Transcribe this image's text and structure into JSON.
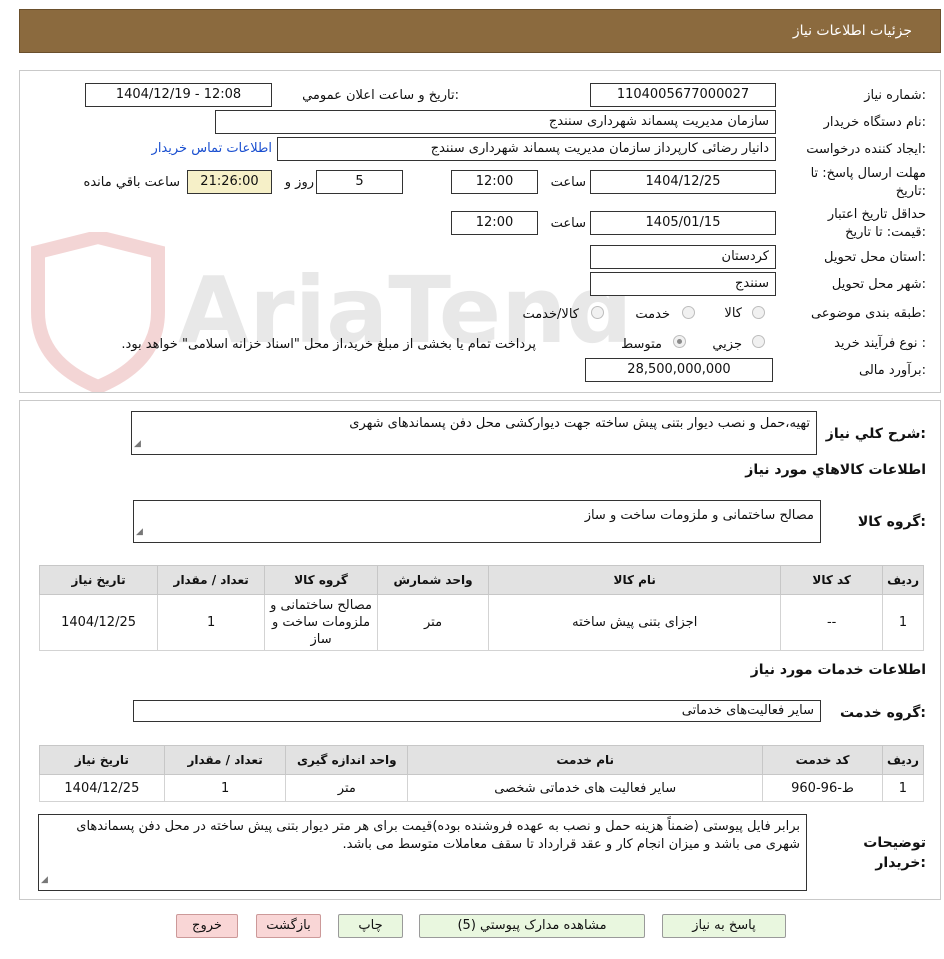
{
  "header": {
    "title": "جزئیات اطلاعات نیاز"
  },
  "form": {
    "need_number_label": "شماره نیاز:",
    "need_number": "1104005677000027",
    "announce_label": "تاریخ و ساعت اعلان عمومي:",
    "announce_value": "1404/12/19 - 12:08",
    "buyer_org_label": "نام دستگاه خریدار:",
    "buyer_org": "سازمان مدیریت پسماند شهرداری سنندج",
    "requester_label": "ایجاد کننده درخواست:",
    "requester": "دانیار رضائی کارپرداز سازمان مدیریت پسماند شهرداری سنندج",
    "contact_link": "اطلاعات تماس خریدار",
    "deadline_label": "مهلت ارسال پاسخ: تا تاریخ:",
    "deadline_date": "1404/12/25",
    "time_label": "ساعت",
    "deadline_time": "12:00",
    "days_value": "5",
    "days_label": "روز و",
    "remaining_time": "21:26:00",
    "remaining_label": "ساعت باقي مانده",
    "validity_label": "حداقل تاریخ اعتبار قیمت: تا تاریخ:",
    "validity_date": "1405/01/15",
    "validity_time": "12:00",
    "province_label": "استان محل تحویل:",
    "province": "کردستان",
    "city_label": "شهر محل تحویل:",
    "city": "سنندج",
    "category_label": "طبقه بندی موضوعی:",
    "category_options": [
      "کالا",
      "خدمت",
      "کالا/خدمت"
    ],
    "process_label": "نوع فرآیند خرید :",
    "process_options": [
      "جزیي",
      "متوسط"
    ],
    "process_note": "پرداخت تمام یا بخشی از مبلغ خرید،از محل \"اسناد خزانه اسلامی\" خواهد بود.",
    "budget_label": "برآورد مالی:",
    "budget": "28,500,000,000"
  },
  "summary": {
    "label": "شرح کلي نیاز:",
    "text": "تهیه،حمل و نصب دیوار بتنی پیش ساخته جهت دیوارکشی محل دفن پسماندهای شهری"
  },
  "goods": {
    "section_title": "اطلاعات کالاهاي مورد نیاز",
    "group_label": "گروه کالا:",
    "group_value": "مصالح ساختمانی و ملزومات ساخت و ساز",
    "columns": [
      "ردیف",
      "کد کالا",
      "نام کالا",
      "واحد شمارش",
      "گروه کالا",
      "تعداد / مقدار",
      "تاریخ نیاز"
    ],
    "rows": [
      [
        "1",
        "--",
        "اجزای بتنی پیش ساخته",
        "متر",
        "مصالح ساختمانی و ملزومات ساخت و ساز",
        "1",
        "1404/12/25"
      ]
    ]
  },
  "services": {
    "section_title": "اطلاعات خدمات مورد نیاز",
    "group_label": "گروه خدمت:",
    "group_value": "سایر فعالیت‌های خدماتی",
    "columns": [
      "ردیف",
      "کد خدمت",
      "نام خدمت",
      "واحد اندازه گیری",
      "تعداد / مقدار",
      "تاریخ نیاز"
    ],
    "rows": [
      [
        "1",
        "ط-96-960",
        "سایر فعالیت های خدماتی شخصی",
        "متر",
        "1",
        "1404/12/25"
      ]
    ]
  },
  "buyer_notes": {
    "label": "توضیحات خریدار:",
    "text": "برابر فایل پیوستی (ضمناً هزینه حمل و نصب به عهده فروشنده بوده)قیمت برای هر متر دیوار بتنی پیش ساخته در محل دفن پسماندهای شهری می باشد و میزان انجام کار و عقد قرارداد تا سقف معاملات متوسط می باشد."
  },
  "buttons": {
    "reply": "پاسخ به نیاز",
    "attachments": "مشاهده مدارک پیوستي (5)",
    "print": "چاپ",
    "back": "بازگشت",
    "exit": "خروج"
  },
  "watermark": {
    "text": "AriaTender.neT"
  }
}
